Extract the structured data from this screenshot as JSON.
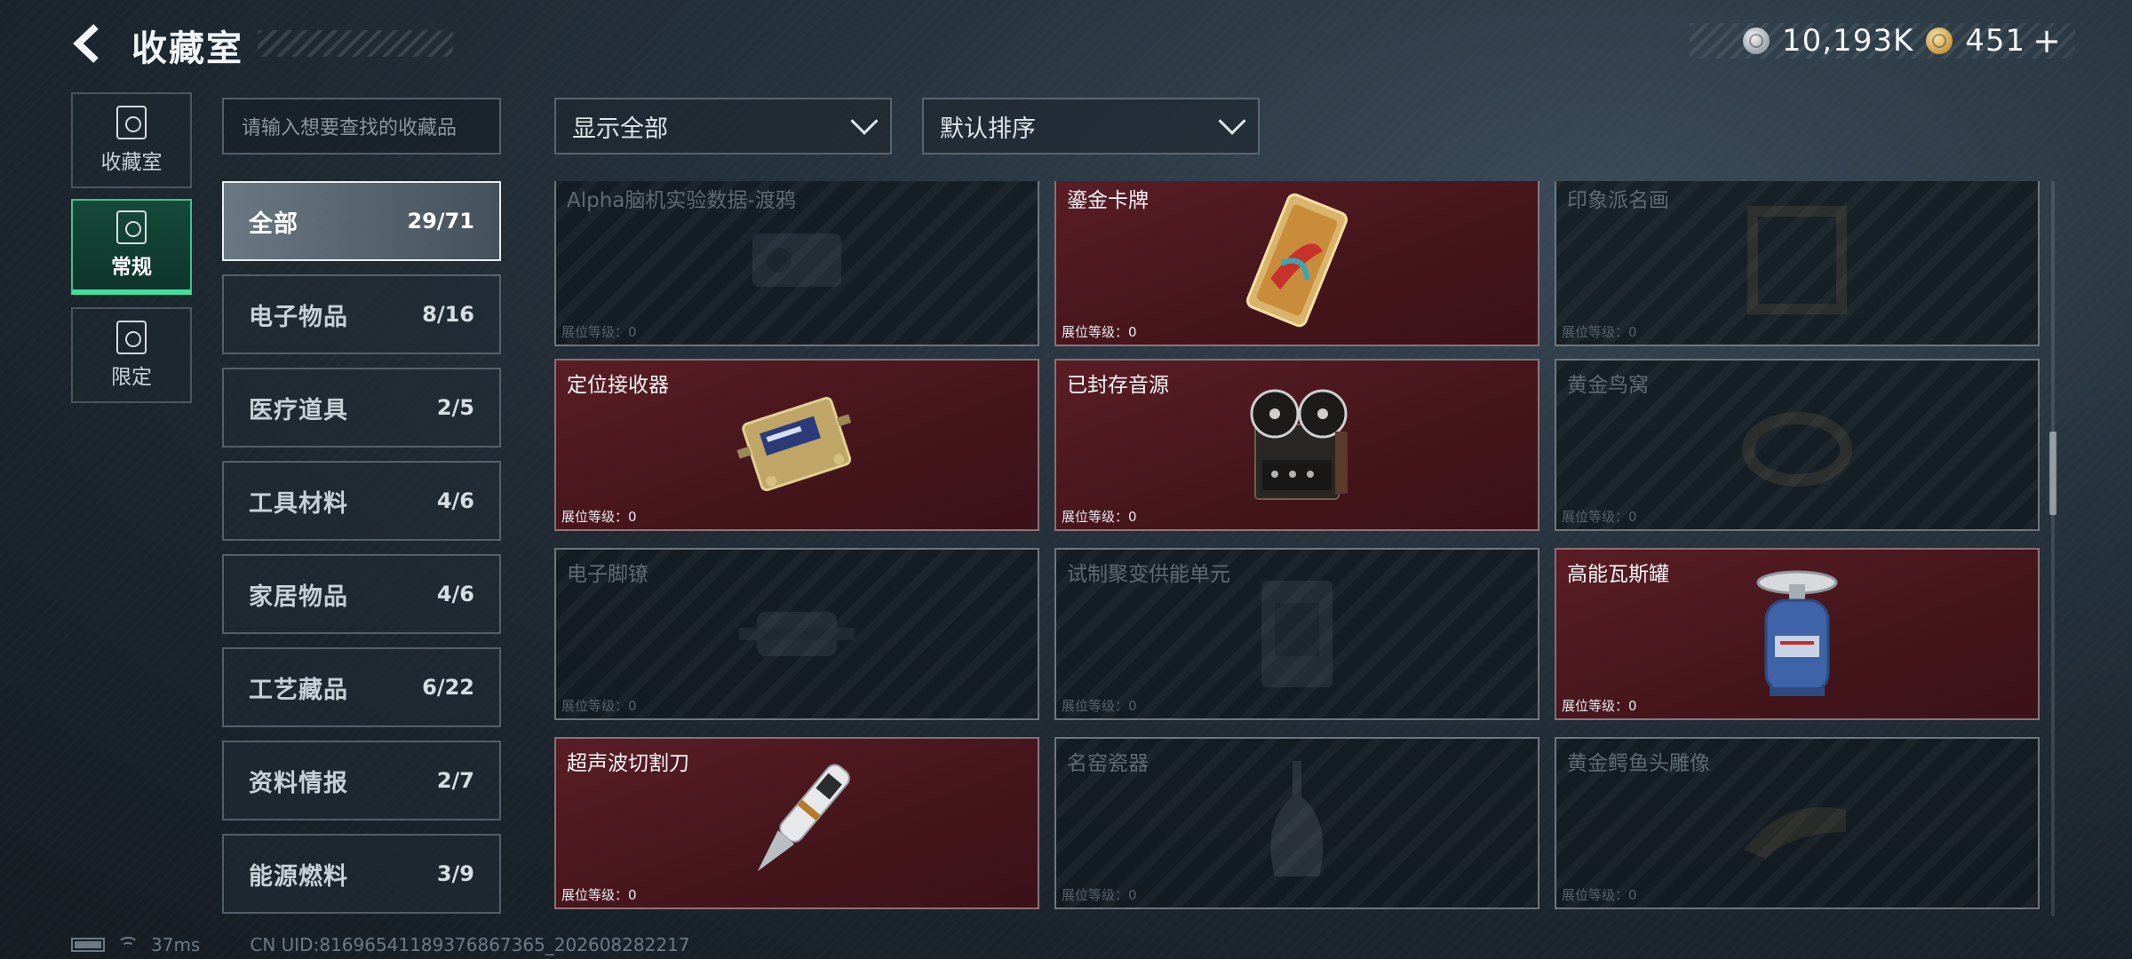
{
  "header": {
    "title": "收藏室",
    "currency": [
      {
        "icon": "silver-coin-icon",
        "value": "10,193K"
      },
      {
        "icon": "gold-coin-icon",
        "value": "451",
        "plus": "+"
      }
    ]
  },
  "nav": [
    {
      "label": "收藏室",
      "icon": "collection-room-icon",
      "active": false
    },
    {
      "label": "常规",
      "icon": "regular-icon",
      "active": true
    },
    {
      "label": "限定",
      "icon": "limited-icon",
      "active": false
    }
  ],
  "search": {
    "placeholder": "请输入想要查找的收藏品"
  },
  "filters": {
    "show": "显示全部",
    "sort": "默认排序"
  },
  "categories": [
    {
      "name": "全部",
      "count": "29/71",
      "active": true
    },
    {
      "name": "电子物品",
      "count": "8/16"
    },
    {
      "name": "医疗道具",
      "count": "2/5"
    },
    {
      "name": "工具材料",
      "count": "4/6"
    },
    {
      "name": "家居物品",
      "count": "4/6"
    },
    {
      "name": "工艺藏品",
      "count": "6/22"
    },
    {
      "name": "资料情报",
      "count": "2/7"
    },
    {
      "name": "能源燃料",
      "count": "3/9"
    }
  ],
  "level_label": "展位等级：0",
  "cards": [
    {
      "name": "Alpha脑机实验数据-渡鸦",
      "unlocked": false,
      "icon": "data-drive-icon"
    },
    {
      "name": "鎏金卡牌",
      "unlocked": true,
      "icon": "gilded-card-icon"
    },
    {
      "name": "印象派名画",
      "unlocked": false,
      "icon": "painting-frame-icon"
    },
    {
      "name": "定位接收器",
      "unlocked": true,
      "icon": "gps-receiver-icon"
    },
    {
      "name": "已封存音源",
      "unlocked": true,
      "icon": "reel-recorder-icon"
    },
    {
      "name": "黄金鸟窝",
      "unlocked": false,
      "icon": "golden-nest-icon"
    },
    {
      "name": "电子脚镣",
      "unlocked": false,
      "icon": "ankle-monitor-icon"
    },
    {
      "name": "试制聚变供能单元",
      "unlocked": false,
      "icon": "fusion-cell-icon"
    },
    {
      "name": "高能瓦斯罐",
      "unlocked": true,
      "icon": "gas-canister-icon"
    },
    {
      "name": "超声波切割刀",
      "unlocked": true,
      "icon": "ultrasonic-knife-icon"
    },
    {
      "name": "名窑瓷器",
      "unlocked": false,
      "icon": "porcelain-vase-icon"
    },
    {
      "name": "黄金鳄鱼头雕像",
      "unlocked": false,
      "icon": "golden-croc-icon"
    }
  ],
  "footer": {
    "ping": "37ms",
    "uid": "CN UID:8169654118937686736​5_202608282217"
  }
}
